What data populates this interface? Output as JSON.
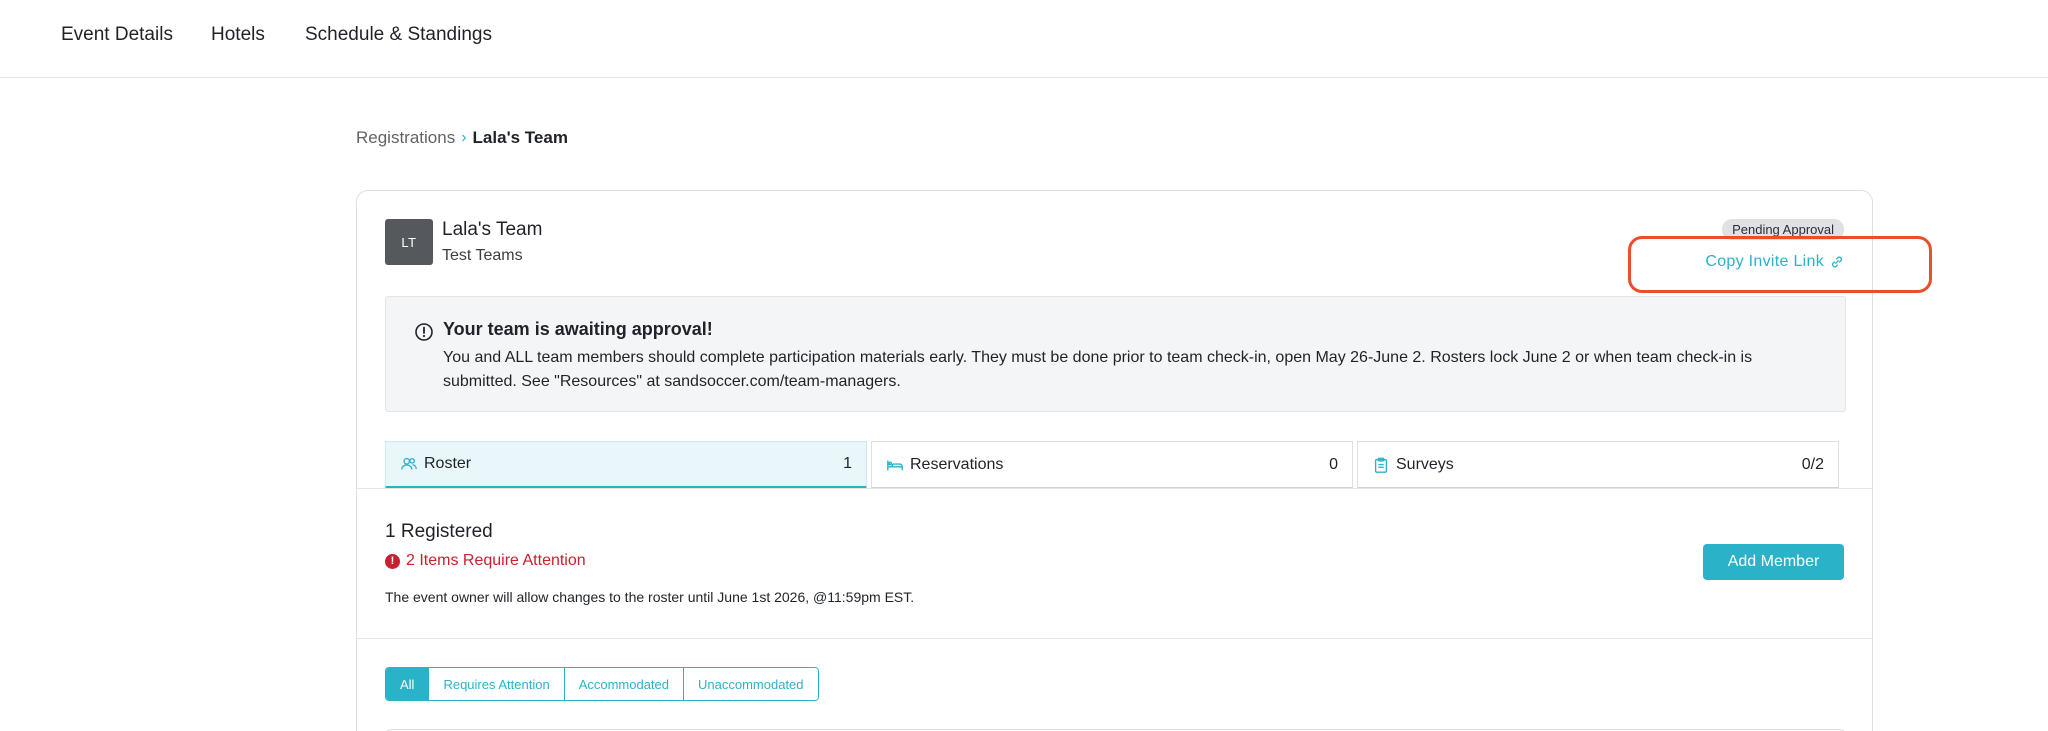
{
  "nav": {
    "items": [
      "Event Details",
      "Hotels",
      "Schedule & Standings"
    ]
  },
  "breadcrumb": {
    "parent": "Registrations",
    "separator": "›",
    "current": "Lala's Team"
  },
  "team": {
    "initials": "LT",
    "name": "Lala's Team",
    "subtitle": "Test Teams",
    "status": "Pending Approval",
    "copy_link_label": "Copy Invite Link"
  },
  "alert": {
    "title": "Your team is awaiting approval!",
    "body": "You and ALL team members should complete participation materials early. They must be done prior to team check-in, open May 26-June 2. Rosters lock June 2 or when team check-in is submitted. See \"Resources\" at sandsoccer.com/team-managers."
  },
  "tabs": [
    {
      "label": "Roster",
      "count": "1",
      "icon": "users-icon"
    },
    {
      "label": "Reservations",
      "count": "0",
      "icon": "bed-icon"
    },
    {
      "label": "Surveys",
      "count": "0/2",
      "icon": "clipboard-icon"
    }
  ],
  "roster": {
    "registered": "1 Registered",
    "attention": "2 Items Require Attention",
    "note": "The event owner will allow changes to the roster until June 1st 2026, @11:59pm EST.",
    "add_member_label": "Add Member"
  },
  "filters": [
    "All",
    "Requires Attention",
    "Accommodated",
    "Unaccommodated"
  ],
  "colors": {
    "accent": "#2ab3c8",
    "error": "#c8202f",
    "highlight": "#e8502b"
  }
}
